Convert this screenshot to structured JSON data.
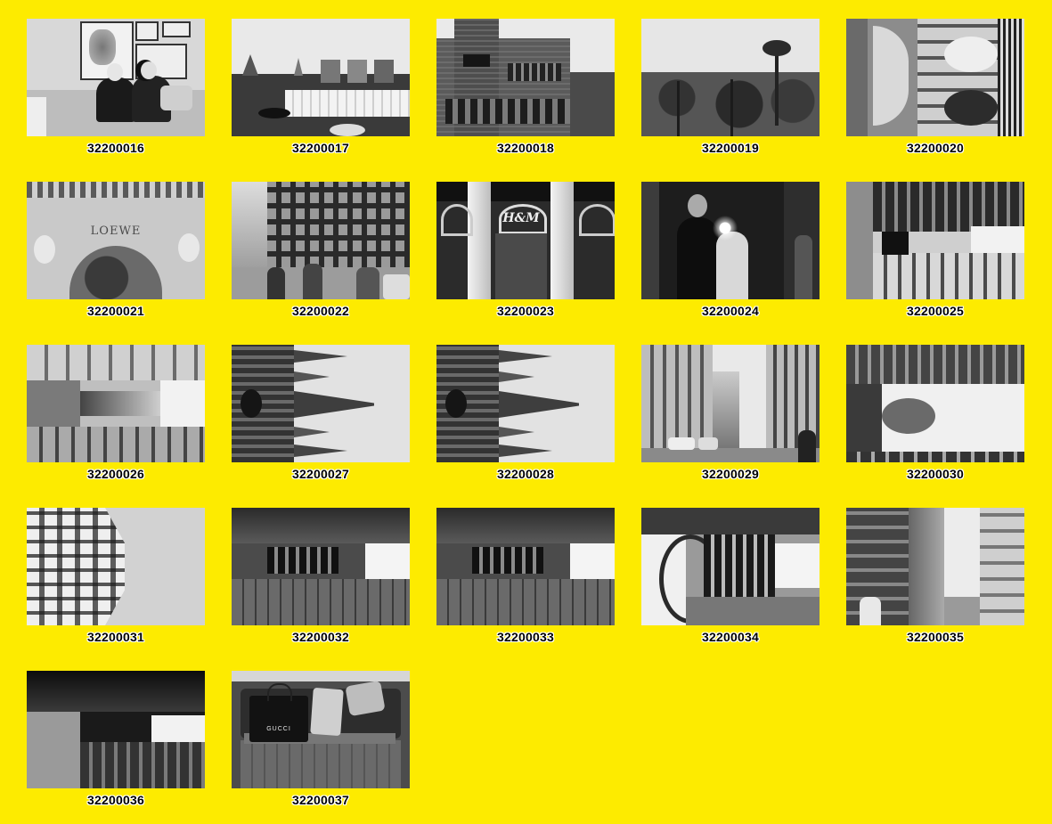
{
  "contact_sheet": {
    "frames": [
      {
        "id": "32200016",
        "scene": "couple-on-sofa"
      },
      {
        "id": "32200017",
        "scene": "rooftop-pool"
      },
      {
        "id": "32200018",
        "scene": "brick-building"
      },
      {
        "id": "32200019",
        "scene": "palm-trees"
      },
      {
        "id": "32200020",
        "scene": "modernist-facade-rotated"
      },
      {
        "id": "32200021",
        "scene": "loewe-arch",
        "sign": "LOEWE"
      },
      {
        "id": "32200022",
        "scene": "street-crowd"
      },
      {
        "id": "32200023",
        "scene": "store-entrance",
        "sign": "H&M"
      },
      {
        "id": "32200024",
        "scene": "mirror-selfie"
      },
      {
        "id": "32200025",
        "scene": "street-rotated"
      },
      {
        "id": "32200026",
        "scene": "narrow-street-rotated"
      },
      {
        "id": "32200027",
        "scene": "cathedral-spires"
      },
      {
        "id": "32200028",
        "scene": "cathedral-spires"
      },
      {
        "id": "32200029",
        "scene": "avenue"
      },
      {
        "id": "32200030",
        "scene": "avenue-rotated"
      },
      {
        "id": "32200031",
        "scene": "corner-building-rotated"
      },
      {
        "id": "32200032",
        "scene": "gothic-alley-rotated"
      },
      {
        "id": "32200033",
        "scene": "gothic-alley-rotated"
      },
      {
        "id": "32200034",
        "scene": "gothic-doorway-rotated"
      },
      {
        "id": "32200035",
        "scene": "narrow-street"
      },
      {
        "id": "32200036",
        "scene": "alley-rotated"
      },
      {
        "id": "32200037",
        "scene": "shopping-bag-table",
        "sign": "GUCCI"
      }
    ]
  },
  "colors": {
    "background": "#FDEB00",
    "label_text": "#000000",
    "label_outline": "#FFFFFF"
  }
}
